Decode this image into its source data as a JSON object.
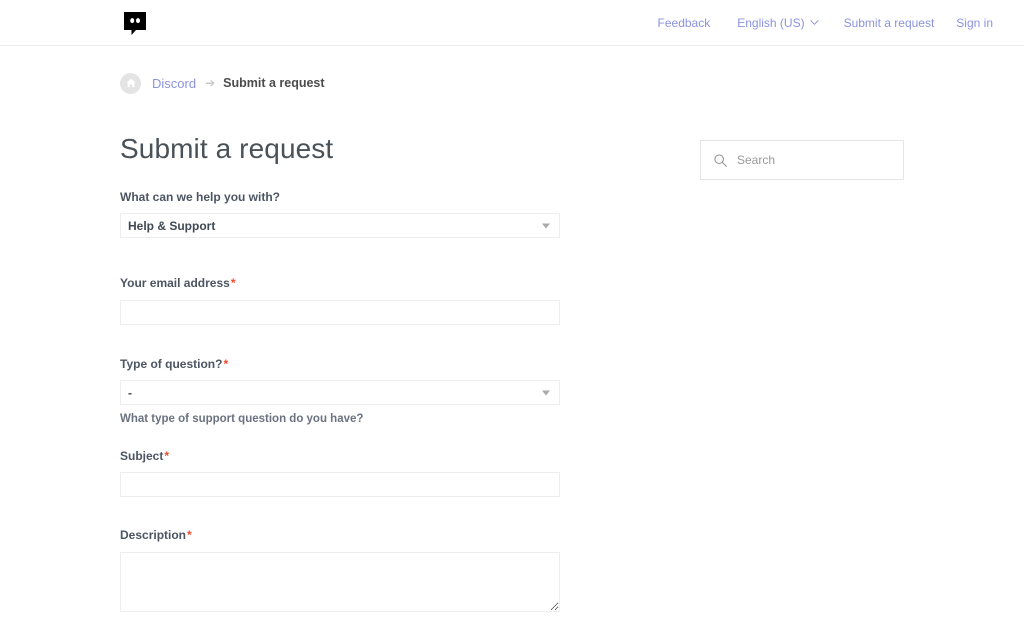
{
  "header": {
    "logo_name": "discord-logo",
    "nav": {
      "feedback": "Feedback",
      "language": "English (US)",
      "submit_request": "Submit a request",
      "sign_in": "Sign in"
    }
  },
  "breadcrumb": {
    "home_icon": "home-icon",
    "root": "Discord",
    "separator": "➔",
    "current": "Submit a request"
  },
  "search": {
    "icon": "search-icon",
    "placeholder": "Search"
  },
  "main": {
    "title": "Submit a request"
  },
  "form": {
    "fields": [
      {
        "label": "What can we help you with?",
        "required": false,
        "type": "select",
        "value": "Help & Support",
        "help": ""
      },
      {
        "label": "Your email address",
        "required": true,
        "type": "input",
        "value": "",
        "help": ""
      },
      {
        "label": "Type of question?",
        "required": true,
        "type": "select",
        "value": "-",
        "help": "What type of support question do you have?"
      },
      {
        "label": "Subject",
        "required": true,
        "type": "input",
        "value": "",
        "help": ""
      },
      {
        "label": "Description",
        "required": true,
        "type": "textarea",
        "value": "",
        "help": ""
      }
    ],
    "required_marker": "*"
  },
  "colors": {
    "link": "#8b93e0",
    "required": "#f4492d",
    "title": "#4a5259",
    "border": "#eceef0"
  }
}
